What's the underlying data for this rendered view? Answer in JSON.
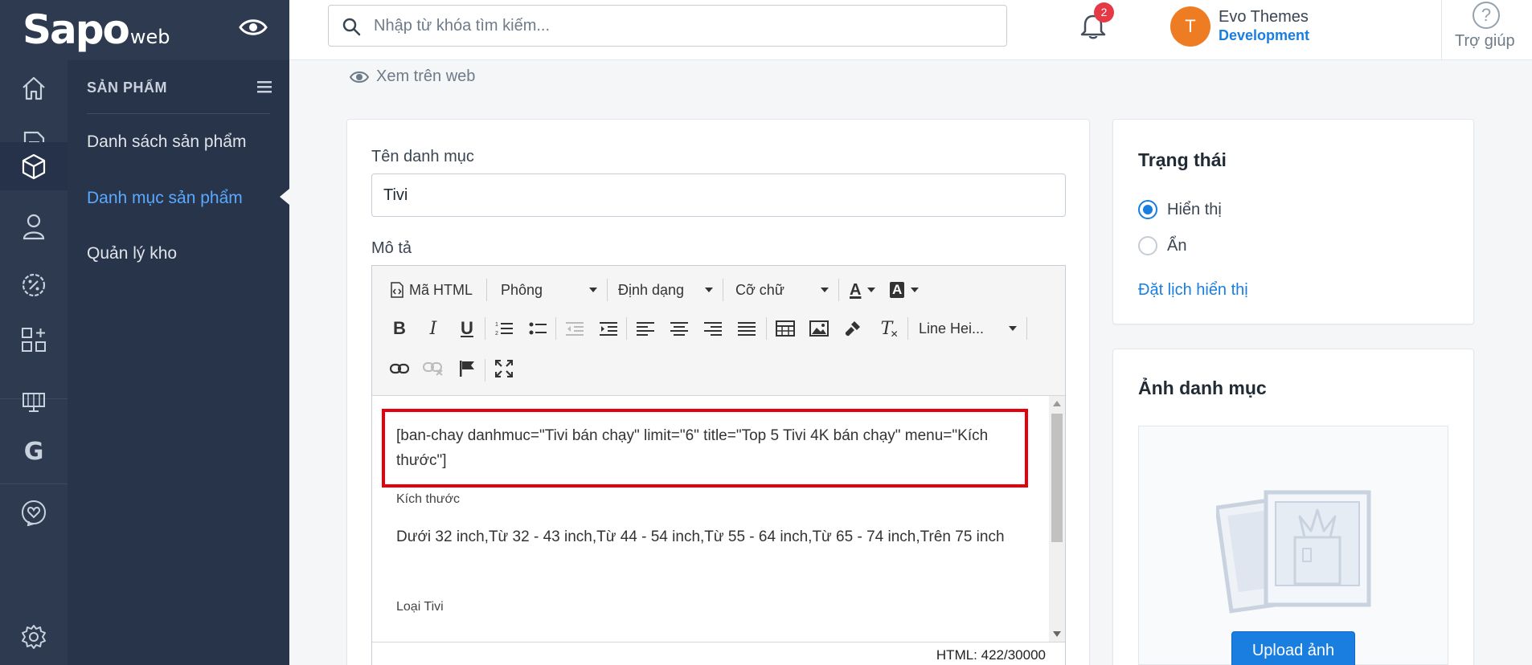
{
  "brand": {
    "logo": "Sapo",
    "logo_suffix": "web"
  },
  "search": {
    "placeholder": "Nhập từ khóa tìm kiếm..."
  },
  "notifications": {
    "count": "2"
  },
  "user": {
    "initial": "T",
    "name": "Evo Themes",
    "role": "Development"
  },
  "help": {
    "label": "Trợ giúp",
    "glyph": "?"
  },
  "rail": {
    "icons": [
      "home-icon",
      "order-document-icon",
      "box-icon",
      "customer-icon",
      "discount-icon",
      "apps-icon",
      "store-icon",
      "google-icon",
      "support-heart-icon",
      "settings-gear-icon"
    ],
    "google_glyph": "G"
  },
  "subnav": {
    "heading": "SẢN PHẨM",
    "items": [
      {
        "label": "Danh sách sản phẩm",
        "active": false
      },
      {
        "label": "Danh mục sản phẩm",
        "active": true
      },
      {
        "label": "Quản lý kho",
        "active": false
      }
    ]
  },
  "page": {
    "view_on_web": "Xem trên web"
  },
  "form": {
    "name_label": "Tên danh mục",
    "name_value": "Tivi",
    "desc_label": "Mô tả"
  },
  "editor": {
    "toolbar": {
      "html_label": "Mã HTML",
      "font_label": "Phông",
      "format_label": "Định dạng",
      "size_label": "Cỡ chữ",
      "line_height_label": "Line Hei...",
      "font_color_glyph": "A",
      "bold_glyph": "B",
      "italic_glyph": "I",
      "underline_glyph": "U",
      "clear_glyph": "T"
    },
    "content": {
      "shortcode": "[ban-chay danhmuc=\"Tivi bán chạy\" limit=\"6\" title=\"Top 5 Tivi 4K bán chạy\" menu=\"Kích thước\"]",
      "heading1": "Kích thước",
      "para1": "Dưới 32 inch,Từ 32 - 43 inch,Từ 44 - 54 inch,Từ 55 - 64 inch,Từ 65 - 74 inch,Trên 75 inch",
      "heading2": "Loại Tivi"
    },
    "char_count": "HTML: 422/30000"
  },
  "status_card": {
    "title": "Trạng thái",
    "options": [
      {
        "label": "Hiển thị",
        "selected": true
      },
      {
        "label": "Ẩn",
        "selected": false
      }
    ],
    "schedule_link": "Đặt lịch hiển thị"
  },
  "image_card": {
    "title": "Ảnh danh mục",
    "upload_label": "Upload ảnh"
  },
  "colors": {
    "sidebar_dark": "#2d3a4f",
    "accent_blue": "#1a7ee0",
    "highlight_red": "#e5000b",
    "avatar_orange": "#ee7c22",
    "badge_red": "#e53945"
  }
}
